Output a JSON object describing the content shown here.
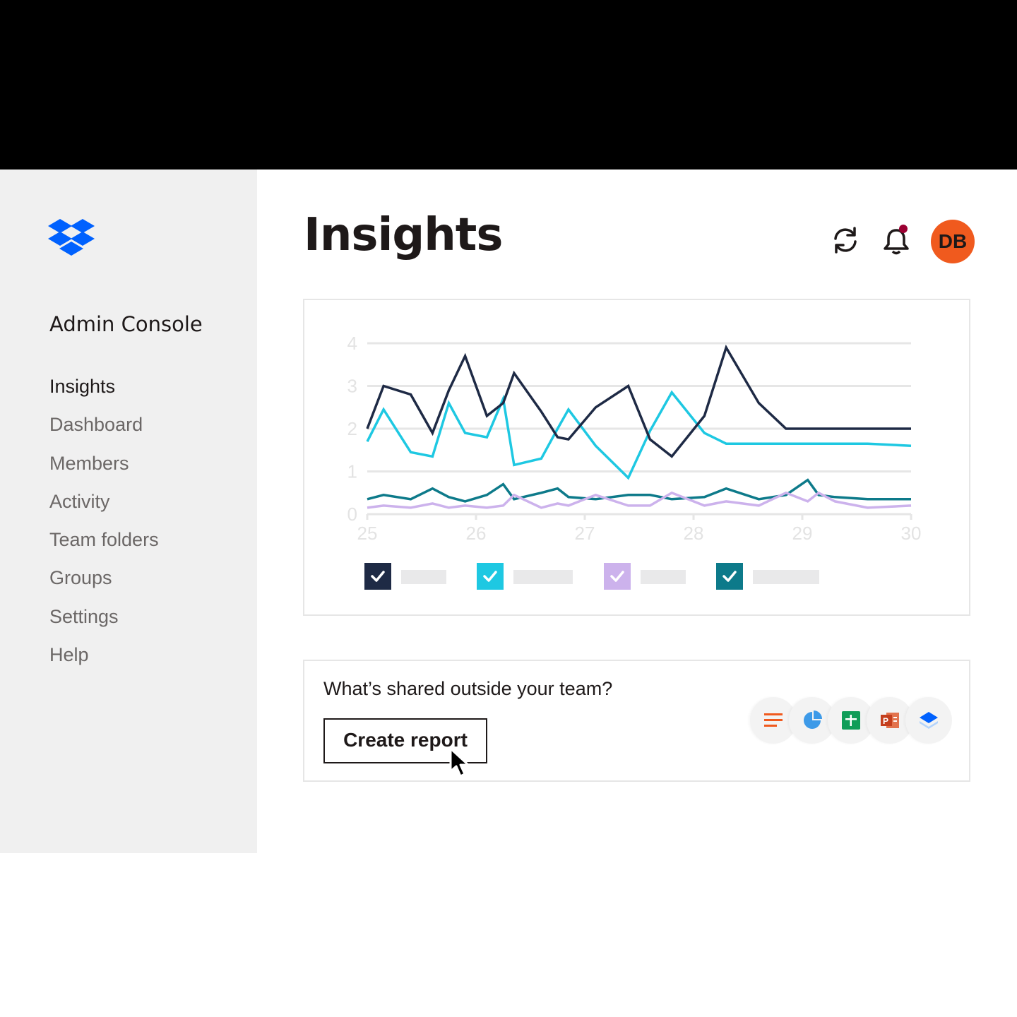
{
  "app": {
    "console_title": "Admin Console",
    "brand_color": "#0061fe",
    "logo_icon": "dropbox-logo-icon"
  },
  "sidebar": {
    "items": [
      {
        "label": "Insights",
        "active": true
      },
      {
        "label": "Dashboard",
        "active": false
      },
      {
        "label": "Members",
        "active": false
      },
      {
        "label": "Activity",
        "active": false
      },
      {
        "label": "Team folders",
        "active": false
      },
      {
        "label": "Groups",
        "active": false
      },
      {
        "label": "Settings",
        "active": false
      },
      {
        "label": "Help",
        "active": false
      }
    ]
  },
  "header": {
    "title": "Insights",
    "refresh_icon": "sync-icon",
    "notification_icon": "bell-icon",
    "notification_dot_color": "#9b0032",
    "avatar_initials": "DB",
    "avatar_color": "#f05a1e"
  },
  "chart_data": {
    "type": "line",
    "x": [
      25,
      25.15,
      25.4,
      25.6,
      25.75,
      25.9,
      26.1,
      26.25,
      26.35,
      26.6,
      26.75,
      26.85,
      27.1,
      27.4,
      27.6,
      27.8,
      28.1,
      28.3,
      28.6,
      28.85,
      29.05,
      29.15,
      29.3,
      29.6,
      30
    ],
    "xlim": [
      25,
      30
    ],
    "ylim": [
      0,
      4
    ],
    "x_ticks": [
      25,
      26,
      27,
      28,
      29,
      30
    ],
    "y_ticks": [
      0,
      1,
      2,
      3,
      4
    ],
    "grid": true,
    "series": [
      {
        "color": "#1e2a45",
        "checked": true,
        "values": [
          2.0,
          3.0,
          2.8,
          1.9,
          2.9,
          3.7,
          2.3,
          2.6,
          3.3,
          2.4,
          1.8,
          1.75,
          2.5,
          3.0,
          1.75,
          1.35,
          2.3,
          3.9,
          2.6,
          2.0,
          2.0,
          2.0,
          2.0,
          2.0,
          2.0
        ]
      },
      {
        "color": "#1ec8e2",
        "checked": true,
        "values": [
          1.7,
          2.45,
          1.45,
          1.35,
          2.6,
          1.9,
          1.8,
          2.7,
          1.15,
          1.3,
          2.0,
          2.45,
          1.6,
          0.85,
          1.95,
          2.85,
          1.9,
          1.65,
          1.65,
          1.65,
          1.65,
          1.65,
          1.65,
          1.65,
          1.6
        ]
      },
      {
        "color": "#ccb2ec",
        "checked": true,
        "values": [
          0.15,
          0.2,
          0.15,
          0.25,
          0.15,
          0.2,
          0.15,
          0.2,
          0.45,
          0.15,
          0.25,
          0.2,
          0.45,
          0.2,
          0.2,
          0.5,
          0.2,
          0.3,
          0.2,
          0.5,
          0.3,
          0.5,
          0.3,
          0.15,
          0.2
        ]
      },
      {
        "color": "#0d7a8a",
        "checked": true,
        "values": [
          0.35,
          0.45,
          0.35,
          0.6,
          0.4,
          0.3,
          0.45,
          0.7,
          0.35,
          0.5,
          0.6,
          0.4,
          0.35,
          0.45,
          0.45,
          0.35,
          0.4,
          0.6,
          0.35,
          0.45,
          0.8,
          0.45,
          0.4,
          0.35,
          0.35
        ]
      }
    ]
  },
  "share_card": {
    "question": "What’s shared outside your team?",
    "button_label": "Create report",
    "file_icons": [
      "document-icon",
      "pie-chart-icon",
      "spreadsheet-icon",
      "presentation-icon",
      "dropbox-stack-icon"
    ]
  }
}
